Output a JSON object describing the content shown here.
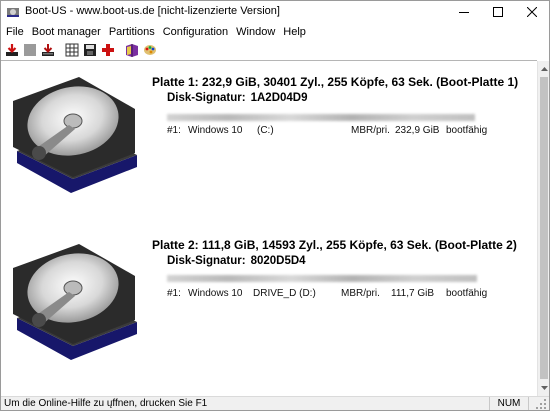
{
  "window": {
    "title": "Boot-US - www.boot-us.de  [nicht-lizenzierte Version]"
  },
  "menu": {
    "items": [
      "File",
      "Boot manager",
      "Partitions",
      "Configuration",
      "Window",
      "Help"
    ]
  },
  "toolbar": {
    "buttons": [
      {
        "icon": "install-boot-manager-icon"
      },
      {
        "icon": "disabled-icon"
      },
      {
        "icon": "uninstall-boot-manager-icon"
      },
      {
        "icon": "partition-table-icon"
      },
      {
        "icon": "save-icon"
      },
      {
        "icon": "add-icon"
      },
      {
        "icon": "book-icon"
      },
      {
        "icon": "palette-icon"
      }
    ]
  },
  "disks": [
    {
      "title": "Platte 1:  232,9 GiB,  30401 Zyl., 255 Köpfe, 63 Sek. (Boot-Platte 1)",
      "signature_label": "Disk-Signatur:",
      "signature": "1A2D04D9",
      "partitions": [
        {
          "num": "#1:",
          "os": "Windows 10",
          "drive": "(C:)",
          "type": "MBR/pri.",
          "size": "232,9 GiB",
          "flag": "bootfähig"
        }
      ]
    },
    {
      "title": "Platte 2:  111,8 GiB,  14593 Zyl., 255 Köpfe, 63 Sek. (Boot-Platte 2)",
      "signature_label": "Disk-Signatur:",
      "signature": "8020D5D4",
      "partitions": [
        {
          "num": "#1:",
          "os": "Windows 10",
          "drive": "DRIVE_D (D:)",
          "type": "MBR/pri.",
          "size": "111,7 GiB",
          "flag": "bootfähig"
        }
      ]
    }
  ],
  "statusbar": {
    "help_text": "Um die Online-Hilfe zu ųffnen, drucken Sie F1",
    "num_indicator": "NUM"
  },
  "colors": {
    "disk_base": "#1a1a6e",
    "platter": "#e8e8e8",
    "accent_red": "#cc1111"
  }
}
